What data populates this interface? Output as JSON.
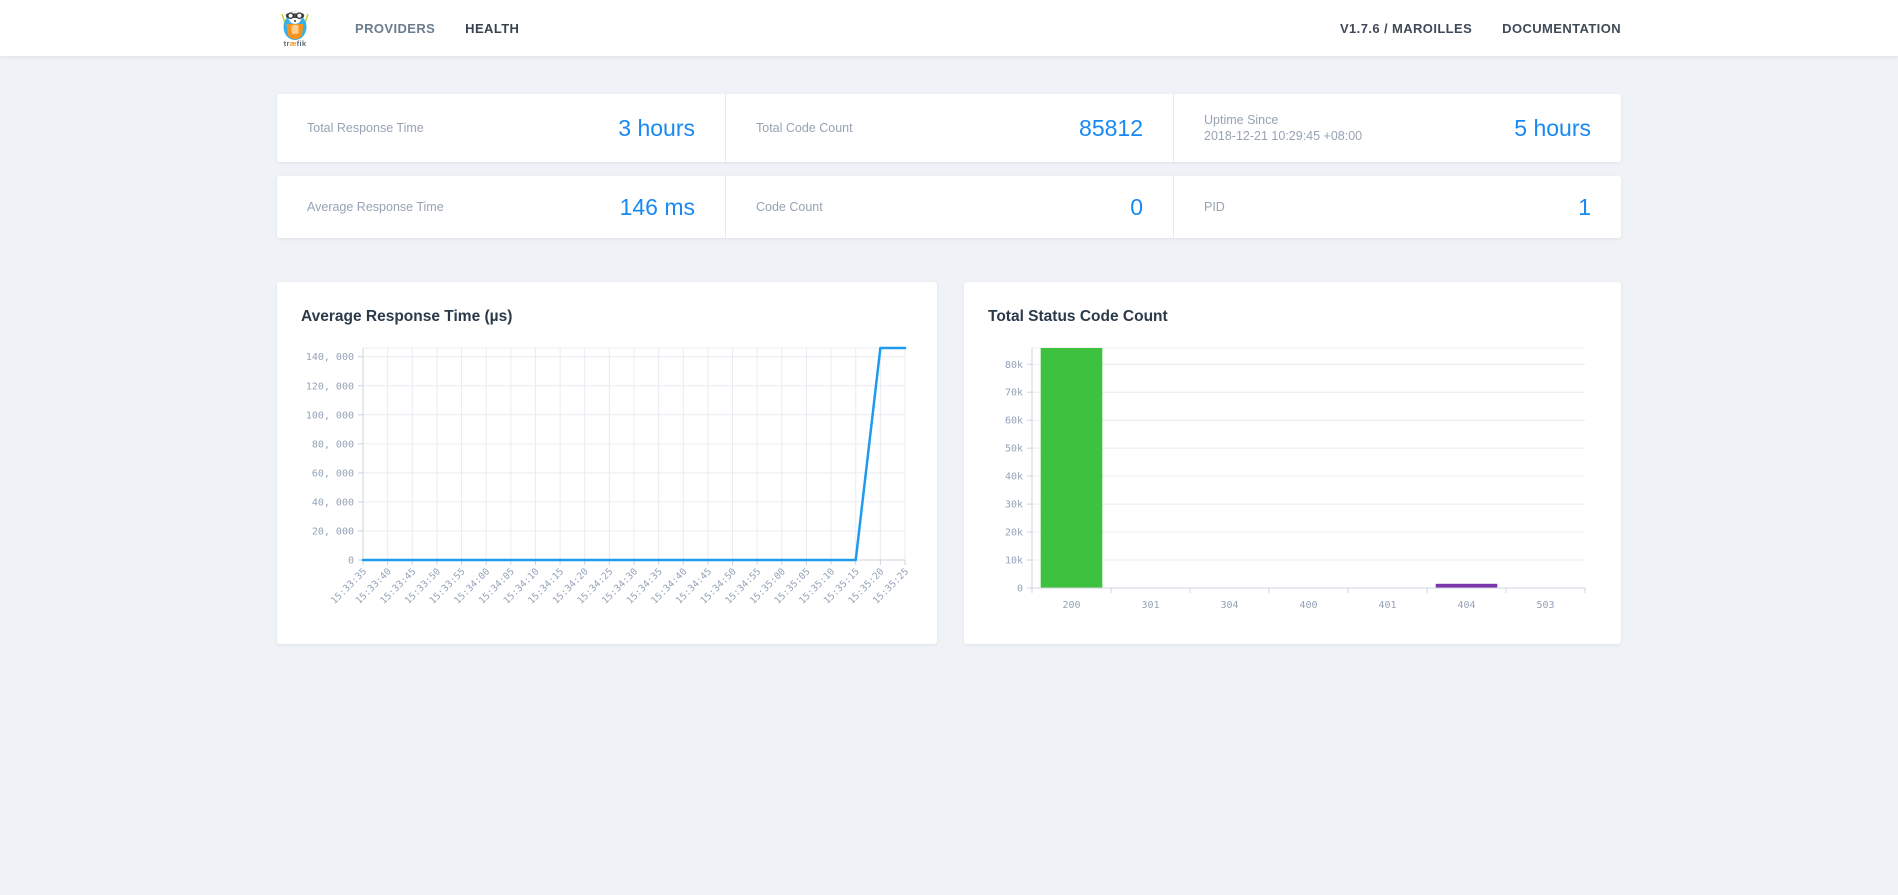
{
  "nav": {
    "logo_text": "træfik",
    "items": [
      {
        "label": "PROVIDERS",
        "active": false
      },
      {
        "label": "HEALTH",
        "active": true
      }
    ],
    "right_items": [
      {
        "label": "V1.7.6 / MAROILLES"
      },
      {
        "label": "DOCUMENTATION"
      }
    ]
  },
  "stats": {
    "rows": [
      [
        {
          "label": "Total Response Time",
          "value": "3 hours"
        },
        {
          "label": "Total Code Count",
          "value": "85812"
        },
        {
          "label": "Uptime Since",
          "sublabel": "2018-12-21 10:29:45 +08:00",
          "value": "5 hours"
        }
      ],
      [
        {
          "label": "Average Response Time",
          "value": "146 ms"
        },
        {
          "label": "Code Count",
          "value": "0"
        },
        {
          "label": "PID",
          "value": "1"
        }
      ]
    ]
  },
  "colors": {
    "accent_blue": "#1789f2",
    "line_blue": "#1e9bef",
    "bar_green": "#3ec13e",
    "bar_purple": "#7b35ab"
  },
  "chart_data": [
    {
      "type": "line",
      "title": "Average Response Time (µs)",
      "xlabel": "",
      "ylabel": "",
      "x": [
        "15:33:35",
        "15:33:40",
        "15:33:45",
        "15:33:50",
        "15:33:55",
        "15:34:00",
        "15:34:05",
        "15:34:10",
        "15:34:15",
        "15:34:20",
        "15:34:25",
        "15:34:30",
        "15:34:35",
        "15:34:40",
        "15:34:45",
        "15:34:50",
        "15:34:55",
        "15:35:00",
        "15:35:05",
        "15:35:10",
        "15:35:15",
        "15:35:20",
        "15:35:25"
      ],
      "values": [
        0,
        0,
        0,
        0,
        0,
        0,
        0,
        0,
        0,
        0,
        0,
        0,
        0,
        0,
        0,
        0,
        0,
        0,
        0,
        0,
        0,
        146000,
        146000
      ],
      "ylim": [
        0,
        146000
      ],
      "y_ticks": [
        0,
        20000,
        40000,
        60000,
        80000,
        100000,
        120000,
        140000
      ],
      "y_tick_labels": [
        "0",
        "20, 000",
        "40, 000",
        "60, 000",
        "80, 000",
        "100, 000",
        "120, 000",
        "140, 000"
      ],
      "grid": "both",
      "legend": "none",
      "line_color": "#1e9bef"
    },
    {
      "type": "bar",
      "title": "Total Status Code Count",
      "xlabel": "",
      "ylabel": "",
      "categories": [
        "200",
        "301",
        "304",
        "400",
        "401",
        "404",
        "503"
      ],
      "values": [
        85812,
        0,
        0,
        0,
        0,
        1500,
        0
      ],
      "colors": [
        "#3ec13e",
        "",
        "",
        "",
        "",
        "#7b35ab",
        ""
      ],
      "ylim": [
        0,
        85812
      ],
      "y_ticks": [
        0,
        10000,
        20000,
        30000,
        40000,
        50000,
        60000,
        70000,
        80000
      ],
      "y_tick_labels": [
        "0",
        "10k",
        "20k",
        "30k",
        "40k",
        "50k",
        "60k",
        "70k",
        "80k"
      ],
      "grid": "horizontal",
      "legend": "none"
    }
  ]
}
